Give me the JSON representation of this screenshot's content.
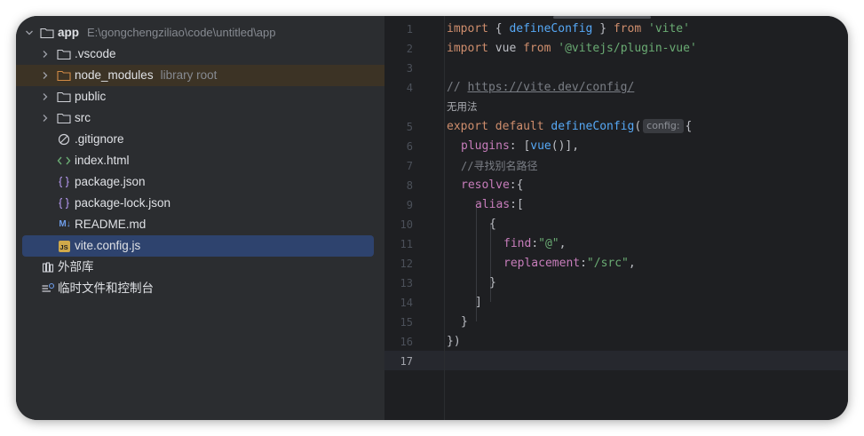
{
  "tree": {
    "root": {
      "name": "app",
      "path": "E:\\gongchengziliao\\code\\untitled\\app"
    },
    "items": [
      {
        "label": "vscode_folder",
        "text": ".vscode"
      },
      {
        "label": "node_modules",
        "text": "node_modules",
        "hint": "library root"
      },
      {
        "label": "public",
        "text": "public"
      },
      {
        "label": "src",
        "text": "src"
      },
      {
        "label": "gitignore",
        "text": ".gitignore"
      },
      {
        "label": "index",
        "text": "index.html"
      },
      {
        "label": "package",
        "text": "package.json"
      },
      {
        "label": "package_lock",
        "text": "package-lock.json"
      },
      {
        "label": "readme",
        "text": "README.md"
      },
      {
        "label": "vite_config",
        "text": "vite.config.js"
      }
    ],
    "external_libraries": "外部库",
    "scratches": "临时文件和控制台",
    "readme_icon_text": "M↓",
    "js_icon_text": "JS"
  },
  "editor": {
    "line_numbers": [
      "1",
      "2",
      "3",
      "4",
      "5",
      "6",
      "7",
      "8",
      "9",
      "10",
      "11",
      "12",
      "13",
      "14",
      "15",
      "16",
      "17"
    ],
    "current_line": "17",
    "code": {
      "l1_import": "import",
      "l1_braces_open": " { ",
      "l1_fn": "defineConfig",
      "l1_braces_close": " } ",
      "l1_from": "from",
      "l1_str": "'vite'",
      "l2_import": "import",
      "l2_name": " vue ",
      "l2_from": "from",
      "l2_str": "'@vitejs/plugin-vue'",
      "l4_comment": "// ",
      "l4_url": "https://vite.dev/config/",
      "l4_note": "无用法",
      "l5_export": "export default ",
      "l5_fn": "defineConfig",
      "l5_paren": "(",
      "l5_hint": "config:",
      "l5_brace": "{",
      "l6_prop": "plugins",
      "l6_rest_a": ": [",
      "l6_fn": "vue",
      "l6_rest_b": "()],",
      "l7_comment": "//寻找别名路径",
      "l8_prop": "resolve",
      "l8_rest": ":{",
      "l9_prop": "alias",
      "l9_rest": ":[",
      "l10": "{",
      "l11_prop": "find",
      "l11_colon": ":",
      "l11_str": "\"@\"",
      "l11_comma": ",",
      "l12_prop": "replacement",
      "l12_colon": ":",
      "l12_str": "\"/src\"",
      "l12_comma": ",",
      "l13": "}",
      "l14": "]",
      "l15": "}",
      "l16": "})"
    }
  },
  "colors": {
    "tree_bg": "#2b2d30",
    "editor_bg": "#1e1f22",
    "selection": "#2e436e",
    "library_highlight": "#3c3325",
    "keyword": "#cf8e6d",
    "function": "#56a8f5",
    "string": "#6aab73",
    "property": "#c77dbb",
    "comment": "#7a7e85"
  }
}
